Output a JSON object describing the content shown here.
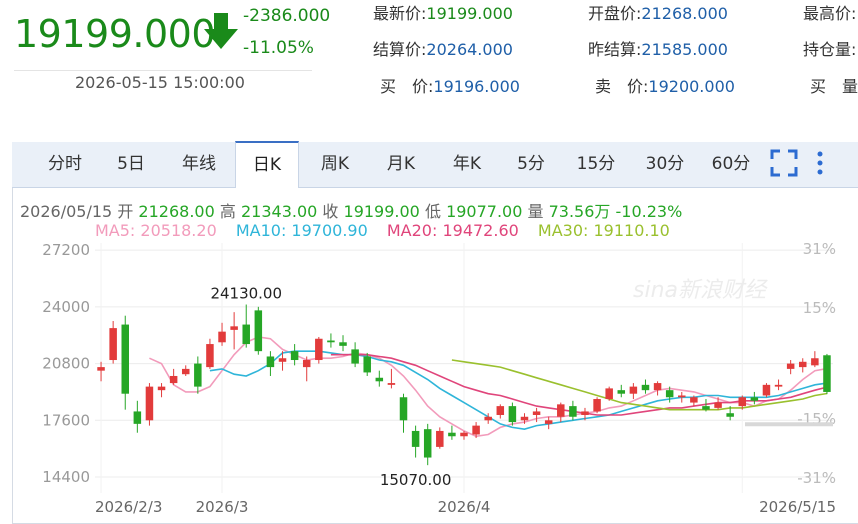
{
  "quote": {
    "last_price": "19199.000",
    "change": "-2386.000",
    "change_pct": "-11.05%",
    "datetime": "2026-05-15 15:00:00",
    "fields": [
      {
        "label": "最新价:",
        "value": "19199.000",
        "color": "green"
      },
      {
        "label": "开盘价:",
        "value": "21268.000",
        "color": "blue"
      },
      {
        "label": "最高价:",
        "value": "",
        "color": "blue"
      },
      {
        "label": "结算价:",
        "value": "20264.000",
        "color": "blue"
      },
      {
        "label": "昨结算:",
        "value": "21585.000",
        "color": "blue"
      },
      {
        "label": "持仓量:",
        "value": "",
        "color": "blue"
      },
      {
        "label": "买　价:",
        "value": "19196.000",
        "color": "blue"
      },
      {
        "label": "卖　价:",
        "value": "19200.000",
        "color": "blue"
      },
      {
        "label": "买　量:",
        "value": "",
        "color": "blue"
      }
    ],
    "colors": {
      "down": "#1a8a1a",
      "value": "#1f5fa8"
    }
  },
  "tabs": [
    "分时",
    "5日",
    "年线",
    "日K",
    "周K",
    "月K",
    "年K",
    "5分",
    "15分",
    "30分",
    "60分"
  ],
  "active_tab": "日K",
  "toolbar": {
    "fullscreen_icon": "fullscreen-icon",
    "more_icon": "more-vertical-icon"
  },
  "info": {
    "date": "2026/05/15",
    "open_label": "开",
    "open": "21268.00",
    "high_label": "高",
    "high": "21343.00",
    "close_label": "收",
    "close": "19199.00",
    "low_label": "低",
    "low": "19077.00",
    "vol_label": "量",
    "vol": "73.56万",
    "pct": "-10.23%"
  },
  "ma_legend": [
    {
      "text": "MA5: 20518.20",
      "color": "#f29bbb"
    },
    {
      "text": "MA10: 19700.90",
      "color": "#2fb5d9"
    },
    {
      "text": "MA20: 19472.60",
      "color": "#e0457b"
    },
    {
      "text": "MA30: 19110.10",
      "color": "#9ac02e"
    }
  ],
  "watermark": "sina新浪财经",
  "chart_data": {
    "type": "candlestick",
    "y_ticks": [
      "27200",
      "24000",
      "20800",
      "17600",
      "14400"
    ],
    "y_ticks_values": [
      27200,
      24000,
      20800,
      17600,
      14400
    ],
    "pct_ticks": [
      "31%",
      "15%",
      "-15%",
      "-31%"
    ],
    "pct_ticks_values": [
      31,
      15,
      -15,
      -31
    ],
    "x_ticks": [
      "2026/2/3",
      "2026/3",
      "2026/4",
      "2026/5/15"
    ],
    "x_ticks_index": [
      0,
      10,
      30,
      53
    ],
    "ylim": [
      13500,
      27600
    ],
    "reference_close": 20800,
    "annotations": [
      {
        "text": "24130.00",
        "index": 12,
        "value": 24130
      },
      {
        "text": "15070.00",
        "index": 26,
        "value": 15070
      }
    ],
    "up_color": "#e23b3b",
    "down_color": "#26a626",
    "candles": [
      {
        "o": 20400,
        "h": 20900,
        "l": 19800,
        "c": 20600
      },
      {
        "o": 21000,
        "h": 23200,
        "l": 20800,
        "c": 22800
      },
      {
        "o": 23000,
        "h": 23500,
        "l": 18200,
        "c": 19100
      },
      {
        "o": 18100,
        "h": 18700,
        "l": 16900,
        "c": 17400
      },
      {
        "o": 17600,
        "h": 19700,
        "l": 17300,
        "c": 19500
      },
      {
        "o": 19300,
        "h": 19700,
        "l": 18900,
        "c": 19500
      },
      {
        "o": 19700,
        "h": 20500,
        "l": 19600,
        "c": 20100
      },
      {
        "o": 20200,
        "h": 20700,
        "l": 20100,
        "c": 20500
      },
      {
        "o": 20800,
        "h": 21200,
        "l": 19100,
        "c": 19500
      },
      {
        "o": 20600,
        "h": 22200,
        "l": 20500,
        "c": 21900
      },
      {
        "o": 22000,
        "h": 23100,
        "l": 21800,
        "c": 22600
      },
      {
        "o": 22700,
        "h": 23700,
        "l": 21600,
        "c": 22900
      },
      {
        "o": 23000,
        "h": 24130,
        "l": 21700,
        "c": 21900
      },
      {
        "o": 23800,
        "h": 24000,
        "l": 21300,
        "c": 21500
      },
      {
        "o": 21200,
        "h": 21500,
        "l": 20100,
        "c": 20600
      },
      {
        "o": 20900,
        "h": 21500,
        "l": 20400,
        "c": 21100
      },
      {
        "o": 21500,
        "h": 21900,
        "l": 20700,
        "c": 21000
      },
      {
        "o": 20600,
        "h": 21200,
        "l": 19800,
        "c": 21000
      },
      {
        "o": 21000,
        "h": 22300,
        "l": 20800,
        "c": 22200
      },
      {
        "o": 22100,
        "h": 22500,
        "l": 21700,
        "c": 22000
      },
      {
        "o": 22000,
        "h": 22400,
        "l": 21500,
        "c": 21800
      },
      {
        "o": 21600,
        "h": 22000,
        "l": 20600,
        "c": 20800
      },
      {
        "o": 21200,
        "h": 21400,
        "l": 20100,
        "c": 20300
      },
      {
        "o": 20000,
        "h": 20400,
        "l": 19500,
        "c": 19800
      },
      {
        "o": 19600,
        "h": 20500,
        "l": 19400,
        "c": 19700
      },
      {
        "o": 18900,
        "h": 19100,
        "l": 16900,
        "c": 17600
      },
      {
        "o": 17000,
        "h": 17300,
        "l": 15500,
        "c": 16100
      },
      {
        "o": 17100,
        "h": 17400,
        "l": 15070,
        "c": 15500
      },
      {
        "o": 16100,
        "h": 17200,
        "l": 16000,
        "c": 17000
      },
      {
        "o": 16900,
        "h": 17300,
        "l": 16500,
        "c": 16700
      },
      {
        "o": 16700,
        "h": 17000,
        "l": 16500,
        "c": 16900
      },
      {
        "o": 16800,
        "h": 17500,
        "l": 16600,
        "c": 17300
      },
      {
        "o": 17600,
        "h": 18000,
        "l": 17400,
        "c": 17800
      },
      {
        "o": 17900,
        "h": 18500,
        "l": 17700,
        "c": 18400
      },
      {
        "o": 18400,
        "h": 18600,
        "l": 17300,
        "c": 17500
      },
      {
        "o": 17600,
        "h": 18000,
        "l": 17400,
        "c": 17800
      },
      {
        "o": 17900,
        "h": 18300,
        "l": 17500,
        "c": 18100
      },
      {
        "o": 17400,
        "h": 17800,
        "l": 17100,
        "c": 17600
      },
      {
        "o": 17800,
        "h": 18600,
        "l": 17500,
        "c": 18500
      },
      {
        "o": 18400,
        "h": 18700,
        "l": 17600,
        "c": 17800
      },
      {
        "o": 17900,
        "h": 18300,
        "l": 17600,
        "c": 18100
      },
      {
        "o": 18100,
        "h": 18900,
        "l": 18000,
        "c": 18800
      },
      {
        "o": 18800,
        "h": 19500,
        "l": 18700,
        "c": 19400
      },
      {
        "o": 19300,
        "h": 19600,
        "l": 18900,
        "c": 19100
      },
      {
        "o": 19100,
        "h": 19700,
        "l": 18800,
        "c": 19500
      },
      {
        "o": 19600,
        "h": 19900,
        "l": 19100,
        "c": 19300
      },
      {
        "o": 19300,
        "h": 19800,
        "l": 19000,
        "c": 19700
      },
      {
        "o": 19300,
        "h": 19500,
        "l": 18600,
        "c": 18900
      },
      {
        "o": 18900,
        "h": 19200,
        "l": 18600,
        "c": 19000
      },
      {
        "o": 18600,
        "h": 19000,
        "l": 18400,
        "c": 18900
      },
      {
        "o": 18400,
        "h": 18800,
        "l": 18100,
        "c": 18200
      },
      {
        "o": 18300,
        "h": 18900,
        "l": 18200,
        "c": 18600
      },
      {
        "o": 18000,
        "h": 18400,
        "l": 17600,
        "c": 17800
      },
      {
        "o": 18400,
        "h": 19000,
        "l": 18200,
        "c": 18900
      },
      {
        "o": 18900,
        "h": 19200,
        "l": 18500,
        "c": 18700
      },
      {
        "o": 19000,
        "h": 19700,
        "l": 18900,
        "c": 19600
      },
      {
        "o": 19500,
        "h": 19900,
        "l": 19300,
        "c": 19600
      },
      {
        "o": 20500,
        "h": 21000,
        "l": 20200,
        "c": 20800
      },
      {
        "o": 20600,
        "h": 21100,
        "l": 20300,
        "c": 20900
      },
      {
        "o": 20700,
        "h": 21500,
        "l": 20600,
        "c": 21100
      },
      {
        "o": 21268,
        "h": 21343,
        "l": 19077,
        "c": 19199
      }
    ],
    "ma_lines": {
      "MA5": [
        null,
        null,
        null,
        null,
        21100,
        20800,
        19600,
        19200,
        19200,
        19500,
        20400,
        21300,
        22000,
        22300,
        22200,
        21600,
        21300,
        21000,
        21100,
        21100,
        21200,
        21400,
        21300,
        21100,
        20700,
        20100,
        19300,
        18400,
        17800,
        17400,
        17000,
        16700,
        16800,
        17200,
        17400,
        17500,
        17700,
        17800,
        17800,
        17900,
        18000,
        18100,
        18300,
        18400,
        18700,
        19000,
        19300,
        19400,
        19300,
        19200,
        19000,
        18800,
        18600,
        18600,
        18400,
        18700,
        18800,
        19300,
        19900,
        20400,
        20518
      ],
      "MA10": [
        null,
        null,
        null,
        null,
        null,
        null,
        null,
        null,
        null,
        20400,
        20500,
        20200,
        20100,
        20400,
        20800,
        21400,
        21500,
        21500,
        21500,
        21400,
        21300,
        21300,
        21200,
        21000,
        20900,
        20700,
        20300,
        19900,
        19400,
        19000,
        18600,
        18200,
        17800,
        17400,
        17200,
        17100,
        17300,
        17400,
        17500,
        17600,
        17700,
        17800,
        17900,
        18100,
        18300,
        18500,
        18700,
        18800,
        18900,
        18900,
        19000,
        19000,
        18900,
        18900,
        18900,
        18900,
        19000,
        19200,
        19400,
        19600,
        19700
      ],
      "MA20": [
        null,
        null,
        null,
        null,
        null,
        null,
        null,
        null,
        null,
        null,
        null,
        null,
        null,
        null,
        null,
        null,
        null,
        null,
        null,
        21300,
        21300,
        21300,
        21300,
        21200,
        21100,
        20900,
        20700,
        20400,
        20100,
        19800,
        19500,
        19300,
        19100,
        19000,
        18800,
        18600,
        18400,
        18300,
        18200,
        18100,
        18000,
        17900,
        17900,
        17900,
        18000,
        18100,
        18200,
        18300,
        18300,
        18400,
        18500,
        18600,
        18600,
        18700,
        18700,
        18700,
        18800,
        18900,
        19100,
        19300,
        19472
      ],
      "MA30": [
        null,
        null,
        null,
        null,
        null,
        null,
        null,
        null,
        null,
        null,
        null,
        null,
        null,
        null,
        null,
        null,
        null,
        null,
        null,
        null,
        null,
        null,
        null,
        null,
        null,
        null,
        null,
        null,
        null,
        21000,
        20900,
        20800,
        20700,
        20600,
        20400,
        20200,
        20000,
        19800,
        19600,
        19400,
        19200,
        19000,
        18800,
        18600,
        18500,
        18400,
        18300,
        18200,
        18200,
        18200,
        18200,
        18200,
        18300,
        18300,
        18400,
        18500,
        18600,
        18700,
        18800,
        19000,
        19110
      ]
    }
  }
}
